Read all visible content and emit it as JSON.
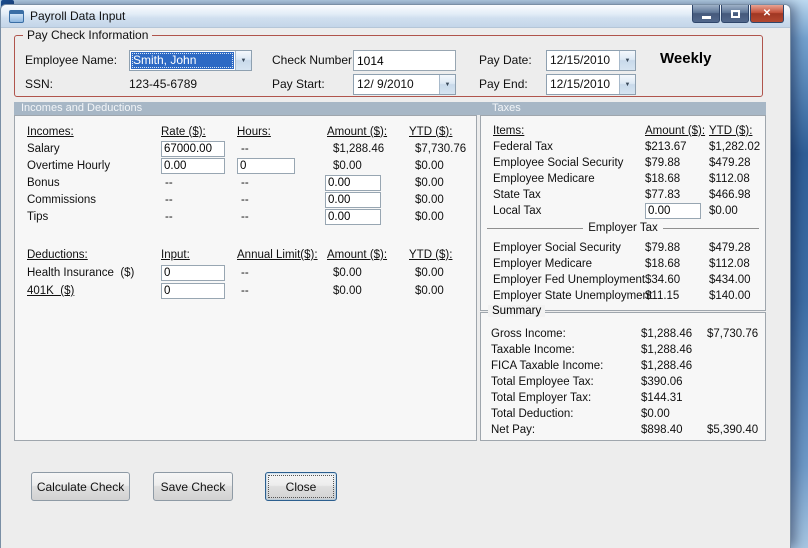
{
  "window": {
    "title": "Payroll Data Input"
  },
  "icons": {
    "dropdown_arrow": "▼",
    "close": "✕"
  },
  "paycheck": {
    "group_title": "Pay Check Information",
    "employee_label": "Employee Name:",
    "employee_value": "Smith, John",
    "ssn_label": "SSN:",
    "ssn_value": "123-45-6789",
    "check_label": "Check Number:",
    "check_value": "1014",
    "pay_start_label": "Pay Start:",
    "pay_start_value": "12/ 9/2010",
    "pay_date_label": "Pay Date:",
    "pay_date_value": "12/15/2010",
    "pay_end_label": "Pay End:",
    "pay_end_value": "12/15/2010",
    "frequency": "Weekly"
  },
  "sections": {
    "left": "Incomes and Deductions",
    "right": "Taxes"
  },
  "incomes": {
    "h": {
      "c1": "Incomes:",
      "c2": "Rate ($):",
      "c3": "Hours:",
      "c4": "Amount ($):",
      "c5": "YTD ($):"
    },
    "rows": [
      {
        "label": "Salary",
        "rate": "67000.00",
        "hours": "--",
        "amount": "$1,288.46",
        "ytd": "$7,730.76"
      },
      {
        "label": "Overtime Hourly",
        "rate": "0.00",
        "hours": "0",
        "amount": "$0.00",
        "ytd": "$0.00"
      },
      {
        "label": "Bonus",
        "rate": "--",
        "hours": "--",
        "amount": "0.00",
        "ytd": "$0.00"
      },
      {
        "label": "Commissions",
        "rate": "--",
        "hours": "--",
        "amount": "0.00",
        "ytd": "$0.00"
      },
      {
        "label": "Tips",
        "rate": "--",
        "hours": "--",
        "amount": "0.00",
        "ytd": "$0.00"
      }
    ]
  },
  "deductions": {
    "h": {
      "c1": "Deductions:",
      "c2": "Input:",
      "c3": "Annual Limit($):",
      "c4": "Amount ($):",
      "c5": "YTD ($):"
    },
    "rows": [
      {
        "label": "Health Insurance  ($)",
        "input": "0",
        "limit": "--",
        "amount": "$0.00",
        "ytd": "$0.00"
      },
      {
        "label": "401K  ($)",
        "input": "0",
        "limit": "--",
        "amount": "$0.00",
        "ytd": "$0.00"
      }
    ]
  },
  "taxes": {
    "h": {
      "c1": "Items:",
      "c2": "Amount ($):",
      "c3": "YTD ($):"
    },
    "rows": [
      {
        "label": "Federal Tax",
        "amount": "$213.67",
        "ytd": "$1,282.02"
      },
      {
        "label": "Employee Social Security",
        "amount": "$79.88",
        "ytd": "$479.28"
      },
      {
        "label": "Employee Medicare",
        "amount": "$18.68",
        "ytd": "$112.08"
      },
      {
        "label": "State Tax",
        "amount": "$77.83",
        "ytd": "$466.98"
      }
    ],
    "local": {
      "label": "Local Tax",
      "amount": "0.00",
      "ytd": "$0.00"
    },
    "employer_label": "Employer Tax",
    "employer_rows": [
      {
        "label": "Employer Social Security",
        "amount": "$79.88",
        "ytd": "$479.28"
      },
      {
        "label": "Employer Medicare",
        "amount": "$18.68",
        "ytd": "$112.08"
      },
      {
        "label": "Employer Fed Unemployment",
        "amount": "$34.60",
        "ytd": "$434.00"
      },
      {
        "label": "Employer State Unemployment",
        "amount": "$11.15",
        "ytd": "$140.00"
      }
    ]
  },
  "summary": {
    "group_title": "Summary",
    "rows": [
      {
        "label": "Gross Income:",
        "amount": "$1,288.46",
        "ytd": "$7,730.76"
      },
      {
        "label": "Taxable Income:",
        "amount": "$1,288.46",
        "ytd": ""
      },
      {
        "label": "FICA Taxable Income:",
        "amount": "$1,288.46",
        "ytd": ""
      },
      {
        "label": "Total Employee Tax:",
        "amount": "$390.06",
        "ytd": ""
      },
      {
        "label": "Total Employer Tax:",
        "amount": "$144.31",
        "ytd": ""
      },
      {
        "label": "Total Deduction:",
        "amount": "$0.00",
        "ytd": ""
      },
      {
        "label": "Net Pay:",
        "amount": "$898.40",
        "ytd": "$5,390.40"
      }
    ]
  },
  "buttons": {
    "calculate": "Calculate Check",
    "save": "Save Check",
    "close": "Close"
  },
  "colors": {
    "paycheck_border": "#B0544C",
    "section_header_bg": "#A7B7C6",
    "selection": "#2E6AC4"
  }
}
